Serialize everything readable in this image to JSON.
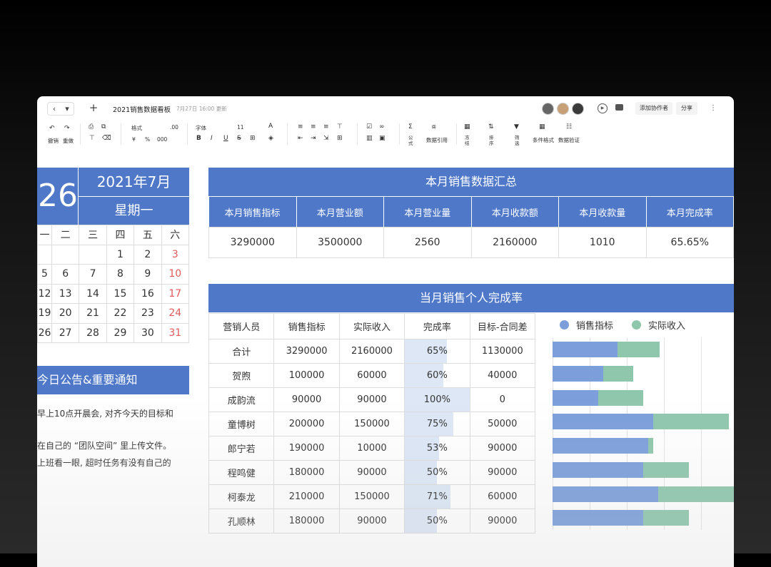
{
  "titlebar": {
    "doc_title": "2021销售数据看板",
    "doc_time": "7月27日 16:00 更新",
    "add_collaborator": "添加协作者",
    "share": "分享"
  },
  "toolbar": {
    "undo": "撤销",
    "redo": "重做",
    "format": "格式",
    "font": "字体",
    "font_size": "11",
    "currency": "¥",
    "percent": "%",
    "thousands": "000",
    "decimal": ".00",
    "formula": "公式",
    "data_ref": "数据引用",
    "freeze": "冻结",
    "sort": "排序",
    "filter": "筛选",
    "cond_format": "条件格式",
    "data_valid": "数据验证"
  },
  "calendar": {
    "day": "26",
    "month": "2021年7月",
    "weekday": "星期一",
    "headers": [
      "一",
      "二",
      "三",
      "四",
      "五",
      "六"
    ],
    "rows": [
      [
        "",
        "",
        "",
        "1",
        "2",
        "3"
      ],
      [
        "5",
        "6",
        "7",
        "8",
        "9",
        "10"
      ],
      [
        "12",
        "13",
        "14",
        "15",
        "16",
        "17"
      ],
      [
        "19",
        "20",
        "21",
        "22",
        "23",
        "24"
      ],
      [
        "26",
        "27",
        "28",
        "29",
        "30",
        "31"
      ]
    ]
  },
  "notice": {
    "title": "今日公告&重要通知",
    "lines": [
      "早上10点开晨会, 对齐今天的目标和",
      "在自己的 “团队空间” 里上传文件。",
      "上班看一眼, 超时任务有没有自己的"
    ]
  },
  "summary": {
    "title": "本月销售数据汇总",
    "headers": [
      "本月销售指标",
      "本月营业额",
      "本月营业量",
      "本月收款额",
      "本月收款量",
      "本月完成率"
    ],
    "values": [
      "3290000",
      "3500000",
      "2560",
      "2160000",
      "1010",
      "65.65%"
    ]
  },
  "perf": {
    "title": "当月销售个人完成率",
    "headers": [
      "营销人员",
      "销售指标",
      "实际收入",
      "完成率",
      "目标-合同差"
    ],
    "rows": [
      {
        "name": "合计",
        "target": "3290000",
        "actual": "2160000",
        "rate": "65%",
        "gap": "1130000",
        "rate_value": 0.65
      },
      {
        "name": "贺煦",
        "target": "100000",
        "actual": "60000",
        "rate": "60%",
        "gap": "40000",
        "rate_value": 0.6
      },
      {
        "name": "成韵流",
        "target": "90000",
        "actual": "90000",
        "rate": "100%",
        "gap": "0",
        "rate_value": 1.0
      },
      {
        "name": "童博树",
        "target": "200000",
        "actual": "150000",
        "rate": "75%",
        "gap": "50000",
        "rate_value": 0.75
      },
      {
        "name": "郎宁若",
        "target": "190000",
        "actual": "10000",
        "rate": "53%",
        "gap": "90000",
        "rate_value": 0.53
      },
      {
        "name": "程鸣健",
        "target": "180000",
        "actual": "90000",
        "rate": "50%",
        "gap": "90000",
        "rate_value": 0.5
      },
      {
        "name": "柯泰龙",
        "target": "210000",
        "actual": "150000",
        "rate": "71%",
        "gap": "60000",
        "rate_value": 0.71
      },
      {
        "name": "孔顺林",
        "target": "180000",
        "actual": "90000",
        "rate": "50%",
        "gap": "90000",
        "rate_value": 0.5
      }
    ],
    "legend": [
      "销售指标",
      "实际收入"
    ]
  },
  "colors": {
    "accent": "#4f78c9",
    "target_bar": "#7c9fdb",
    "actual_bar": "#8fc7ad",
    "weekend_red": "#e05a5a"
  }
}
